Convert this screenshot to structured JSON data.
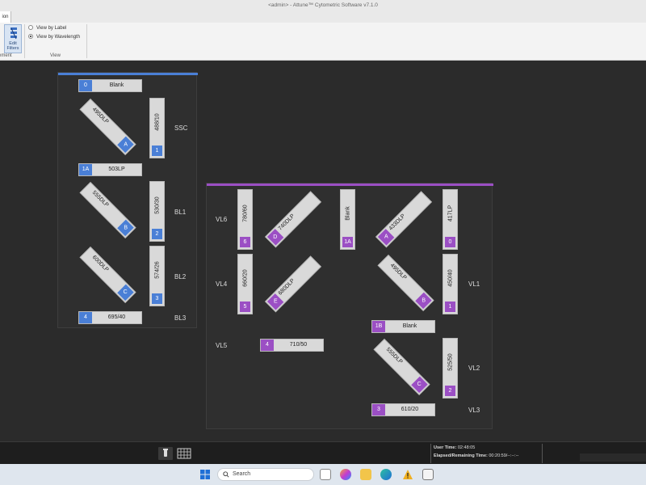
{
  "window": {
    "title": "<admin> - Attune™ Cytometric Software v7.1.0"
  },
  "ribbon": {
    "active_tab_label": "ion",
    "edit_filters_label": "Edit\nFilters",
    "view_group_label": "View",
    "left_group_label": "ement",
    "view_options": [
      {
        "label": "View by Label",
        "selected": false
      },
      {
        "label": "View by Wavelength",
        "selected": true
      }
    ]
  },
  "blue_panel": {
    "accent": "#4a7fd6",
    "filters_h": [
      {
        "num": "0",
        "label": "Blank"
      },
      {
        "num": "1A",
        "label": "503LP"
      },
      {
        "num": "4",
        "label": "695/40"
      }
    ],
    "filters_v": [
      {
        "num": "1",
        "label": "488/10"
      },
      {
        "num": "2",
        "label": "530/30"
      },
      {
        "num": "3",
        "label": "574/26"
      }
    ],
    "dichroics": [
      {
        "letter": "A",
        "label": "495DLP"
      },
      {
        "letter": "B",
        "label": "555DLP"
      },
      {
        "letter": "C",
        "label": "600DLP"
      }
    ],
    "detectors": [
      "SSC",
      "BL1",
      "BL2",
      "BL3"
    ]
  },
  "violet_panel": {
    "accent": "#9b4fc4",
    "filters_v": [
      {
        "num": "6",
        "label": "780/60"
      },
      {
        "num": "5",
        "label": "660/20"
      },
      {
        "num": "1A",
        "label": "Blank"
      },
      {
        "num": "0",
        "label": "417LP"
      },
      {
        "num": "1",
        "label": "450/40"
      },
      {
        "num": "2",
        "label": "525/50"
      }
    ],
    "filters_h": [
      {
        "num": "4",
        "label": "710/50"
      },
      {
        "num": "1B",
        "label": "Blank"
      },
      {
        "num": "3",
        "label": "610/20"
      }
    ],
    "dichroics": [
      {
        "letter": "D",
        "label": "740DLP"
      },
      {
        "letter": "E",
        "label": "680DLP"
      },
      {
        "letter": "A",
        "label": "433DLP"
      },
      {
        "letter": "B",
        "label": "495DLP"
      },
      {
        "letter": "C",
        "label": "555DLP"
      }
    ],
    "detectors": [
      "VL6",
      "VL4",
      "VL5",
      "VL1",
      "VL2",
      "VL3"
    ]
  },
  "status": {
    "user_time_label": "User Time:",
    "user_time": "02:48:05",
    "elapsed_label": "Elapsed/Remaining Time:",
    "elapsed": "00:20:59/--:--:--"
  },
  "taskbar": {
    "search_placeholder": "Search"
  }
}
